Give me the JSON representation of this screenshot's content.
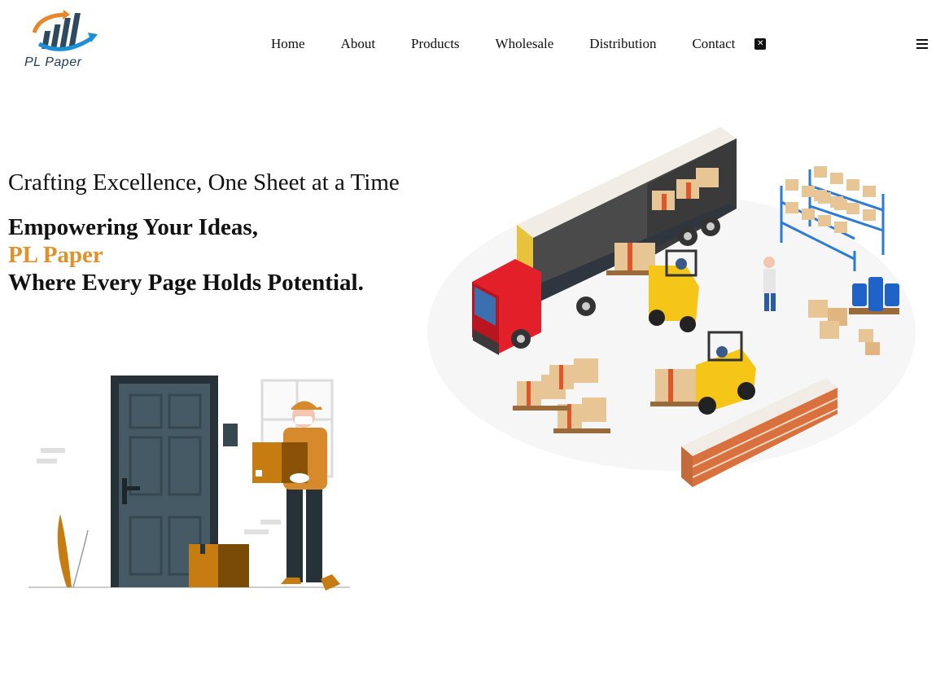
{
  "brand": {
    "name": "PL Paper",
    "logo_icon": "bar-chart-arrow-icon"
  },
  "nav": {
    "items": [
      "Home",
      "About",
      "Products",
      "Wholesale",
      "Distribution",
      "Contact"
    ],
    "close_icon": "x-square-icon",
    "menu_icon": "hamburger-menu-icon"
  },
  "hero": {
    "tagline": "Crafting Excellence, One Sheet at a Time",
    "line1": "Empowering Your Ideas,",
    "line2": "PL Paper",
    "line3": "Where Every Page Holds Potential."
  },
  "colors": {
    "accent": "#e1902a",
    "brand_blue": "#1c3a5e",
    "arrow_blue": "#1d8fd6",
    "arrow_orange": "#e8862a"
  }
}
